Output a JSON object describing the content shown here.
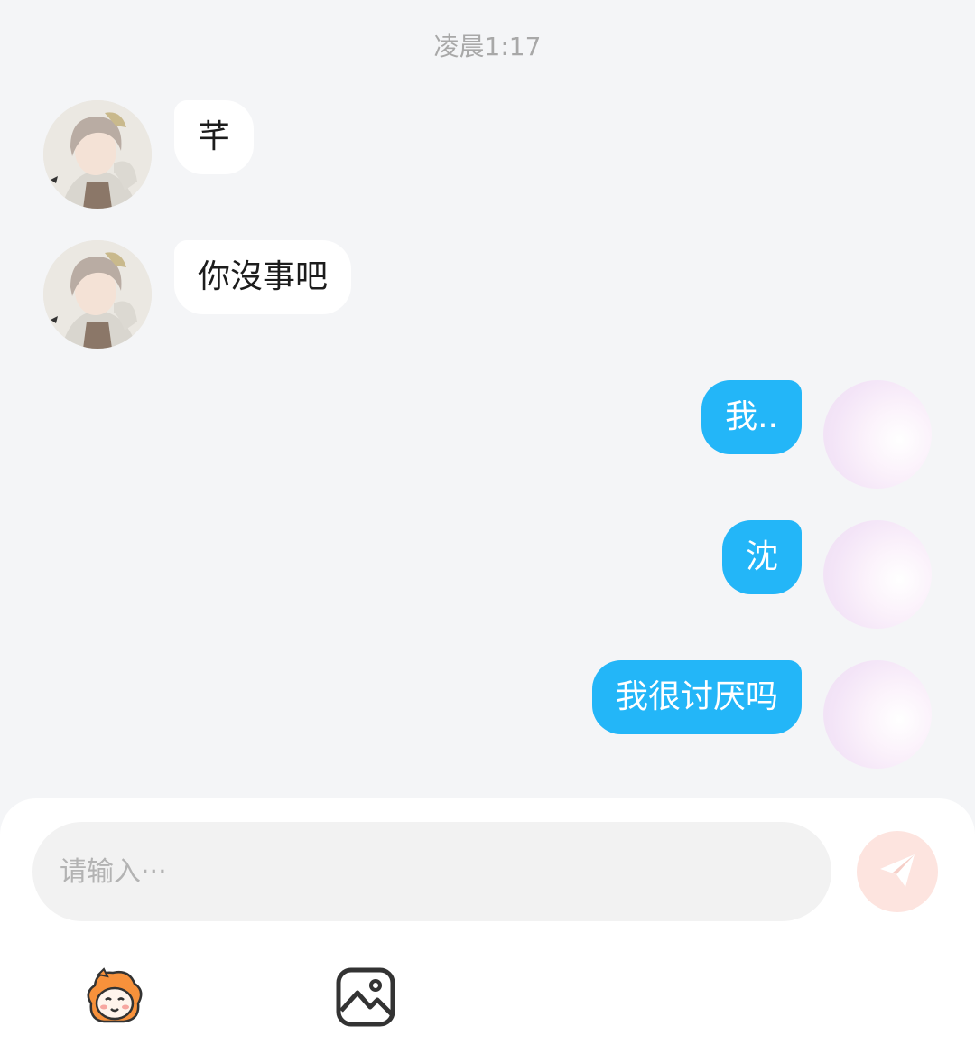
{
  "chat": {
    "timestamp": "凌晨1:17",
    "messages": [
      {
        "side": "in",
        "text": "芊"
      },
      {
        "side": "in",
        "text": "你沒事吧"
      },
      {
        "side": "out",
        "text": "我.."
      },
      {
        "side": "out",
        "text": "沈"
      },
      {
        "side": "out",
        "text": "我很讨厌吗"
      }
    ]
  },
  "composer": {
    "placeholder": "请输入···",
    "send_icon": "send-icon",
    "tools": [
      "sticker-icon",
      "image-icon"
    ]
  },
  "colors": {
    "background": "#f4f5f7",
    "outgoing_bubble": "#23b6f8",
    "incoming_bubble": "#ffffff",
    "send_button": "#fde4df"
  }
}
